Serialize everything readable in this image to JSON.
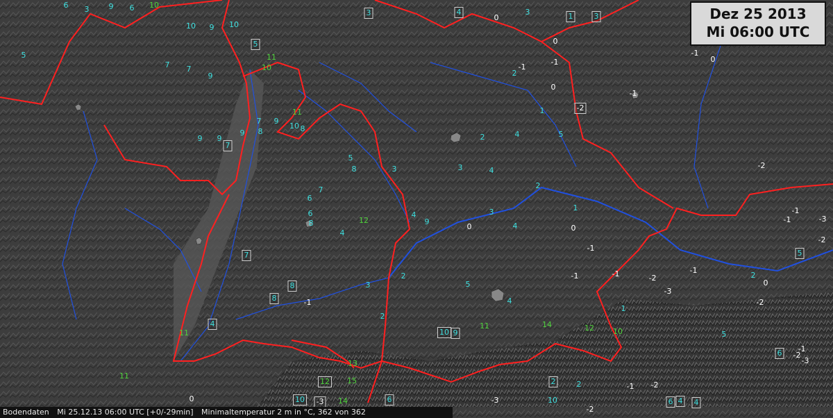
{
  "header": {
    "date": "Dez 25 2013",
    "time": "Mi 06:00 UTC"
  },
  "footer": {
    "source": "Bodendaten",
    "timestamp": "Mi 25.12.13 06:00 UTC [+0/-29min]",
    "description": "Minimaltemperatur 2 m in °C, 362 von 362"
  },
  "legend_colors": {
    "border": "#ff2020",
    "river": "#2050e0",
    "value_default": "#3fe0e0",
    "value_warm": "#4fd33c",
    "value_cold": "#ffffff"
  },
  "stations": [
    {
      "id": "s1",
      "v": "6",
      "c": "cyan"
    },
    {
      "id": "s2",
      "v": "3",
      "c": "cyan"
    },
    {
      "id": "s3",
      "v": "9",
      "c": "cyan"
    },
    {
      "id": "s4",
      "v": "6",
      "c": "cyan"
    },
    {
      "id": "s5",
      "v": "10",
      "c": "green"
    },
    {
      "id": "s6",
      "v": "3",
      "c": "cyan",
      "b": 1
    },
    {
      "id": "s7",
      "v": "4",
      "c": "cyan",
      "b": 1
    },
    {
      "id": "s8",
      "v": "0",
      "c": "white"
    },
    {
      "id": "s9",
      "v": "1",
      "c": "cyan",
      "b": 1
    },
    {
      "id": "s10",
      "v": "3",
      "c": "cyan",
      "b": 1
    },
    {
      "id": "s11",
      "v": "5",
      "c": "cyan"
    },
    {
      "id": "s12",
      "v": "10",
      "c": "cyan"
    },
    {
      "id": "s13",
      "v": "9",
      "c": "cyan"
    },
    {
      "id": "s14",
      "v": "10",
      "c": "cyan"
    },
    {
      "id": "s15",
      "v": "5",
      "c": "cyan",
      "b": 1
    },
    {
      "id": "s16",
      "v": "11",
      "c": "green"
    },
    {
      "id": "s17",
      "v": "10",
      "c": "green"
    },
    {
      "id": "s18",
      "v": "9",
      "c": "cyan"
    },
    {
      "id": "s19",
      "v": "7",
      "c": "cyan"
    },
    {
      "id": "s20",
      "v": "7",
      "c": "cyan"
    },
    {
      "id": "s21",
      "v": "11",
      "c": "green"
    },
    {
      "id": "s22",
      "v": "10",
      "c": "cyan"
    },
    {
      "id": "s23",
      "v": "8",
      "c": "cyan"
    },
    {
      "id": "s24",
      "v": "9",
      "c": "cyan"
    },
    {
      "id": "s25",
      "v": "7",
      "c": "cyan"
    },
    {
      "id": "s26",
      "v": "8",
      "c": "cyan"
    },
    {
      "id": "s27",
      "v": "9",
      "c": "cyan"
    },
    {
      "id": "s28",
      "v": "9",
      "c": "cyan"
    },
    {
      "id": "s29",
      "v": "7",
      "c": "cyan",
      "b": 1
    },
    {
      "id": "s30",
      "v": "9",
      "c": "cyan"
    },
    {
      "id": "s31",
      "v": "4",
      "c": "cyan"
    },
    {
      "id": "s32",
      "v": "5",
      "c": "cyan"
    },
    {
      "id": "s33",
      "v": "8",
      "c": "cyan"
    },
    {
      "id": "s34",
      "v": "3",
      "c": "cyan"
    },
    {
      "id": "s35",
      "v": "3",
      "c": "cyan"
    },
    {
      "id": "s36",
      "v": "4",
      "c": "cyan"
    },
    {
      "id": "s37",
      "v": "4",
      "c": "cyan"
    },
    {
      "id": "s38",
      "v": "2",
      "c": "cyan"
    },
    {
      "id": "s39",
      "v": "2",
      "c": "cyan"
    },
    {
      "id": "s40",
      "v": "1",
      "c": "cyan"
    },
    {
      "id": "s41",
      "v": "3",
      "c": "cyan"
    },
    {
      "id": "s42",
      "v": "0",
      "c": "white"
    },
    {
      "id": "s43",
      "v": "0",
      "c": "white"
    },
    {
      "id": "s44",
      "v": "-1",
      "c": "white"
    },
    {
      "id": "s45",
      "v": "-1",
      "c": "white"
    },
    {
      "id": "s46",
      "v": "-2",
      "c": "white",
      "b": 1
    },
    {
      "id": "s47",
      "v": "-1",
      "c": "white"
    },
    {
      "id": "s48",
      "v": "0",
      "c": "white"
    },
    {
      "id": "s49",
      "v": "-1",
      "c": "white"
    },
    {
      "id": "s50",
      "v": "-3",
      "c": "white"
    },
    {
      "id": "s51",
      "v": "-2",
      "c": "white"
    },
    {
      "id": "s52",
      "v": "-1",
      "c": "white"
    },
    {
      "id": "s53",
      "v": "0",
      "c": "white"
    },
    {
      "id": "s54",
      "v": "-2",
      "c": "white"
    },
    {
      "id": "s55",
      "v": "-1",
      "c": "white"
    },
    {
      "id": "s56",
      "v": "5",
      "c": "cyan",
      "b": 1
    },
    {
      "id": "s57",
      "v": "1",
      "c": "cyan"
    },
    {
      "id": "s58",
      "v": "10",
      "c": "green"
    },
    {
      "id": "s59",
      "v": "14",
      "c": "green"
    },
    {
      "id": "s60",
      "v": "12",
      "c": "green"
    },
    {
      "id": "s61",
      "v": "11",
      "c": "green"
    },
    {
      "id": "s62",
      "v": "10",
      "c": "cyan",
      "b": 1
    },
    {
      "id": "s63",
      "v": "9",
      "c": "cyan",
      "b": 1
    },
    {
      "id": "s64",
      "v": "13",
      "c": "green"
    },
    {
      "id": "s65",
      "v": "15",
      "c": "green"
    },
    {
      "id": "s66",
      "v": "12",
      "c": "green",
      "b": 1
    },
    {
      "id": "s67",
      "v": "10",
      "c": "cyan",
      "b": 1
    },
    {
      "id": "s68",
      "v": "-3",
      "c": "white",
      "b": 1
    },
    {
      "id": "s69",
      "v": "14",
      "c": "green"
    },
    {
      "id": "s70",
      "v": "6",
      "c": "cyan",
      "b": 1
    },
    {
      "id": "s71",
      "v": "-3",
      "c": "white"
    },
    {
      "id": "s72",
      "v": "0",
      "c": "white"
    },
    {
      "id": "s73",
      "v": "11",
      "c": "green"
    },
    {
      "id": "s74",
      "v": "-2",
      "c": "white"
    },
    {
      "id": "s75",
      "v": "-2",
      "c": "white"
    },
    {
      "id": "s76",
      "v": "-3",
      "c": "white"
    },
    {
      "id": "s77",
      "v": "-1",
      "c": "white"
    },
    {
      "id": "s78",
      "v": "5",
      "c": "cyan"
    },
    {
      "id": "s79",
      "v": "9",
      "c": "cyan"
    },
    {
      "id": "s80",
      "v": "2",
      "c": "cyan"
    },
    {
      "id": "s81",
      "v": "3",
      "c": "cyan"
    },
    {
      "id": "s82",
      "v": "4",
      "c": "cyan"
    },
    {
      "id": "s83",
      "v": "0",
      "c": "white"
    },
    {
      "id": "s84",
      "v": "2",
      "c": "cyan"
    },
    {
      "id": "s85",
      "v": "8",
      "c": "cyan",
      "b": 1
    },
    {
      "id": "s86",
      "v": "8",
      "c": "cyan",
      "b": 1
    },
    {
      "id": "s87",
      "v": "4",
      "c": "cyan",
      "b": 1
    },
    {
      "id": "s88",
      "v": "11",
      "c": "green"
    },
    {
      "id": "s89",
      "v": "7",
      "c": "cyan",
      "b": 1
    },
    {
      "id": "s90",
      "v": "12",
      "c": "green"
    },
    {
      "id": "s91",
      "v": "4",
      "c": "cyan"
    },
    {
      "id": "s92",
      "v": "6",
      "c": "cyan"
    },
    {
      "id": "s93",
      "v": "8",
      "c": "cyan"
    },
    {
      "id": "s94",
      "v": "6",
      "c": "cyan"
    },
    {
      "id": "s95",
      "v": "7",
      "c": "cyan"
    },
    {
      "id": "s96",
      "v": "5",
      "c": "cyan"
    },
    {
      "id": "s97",
      "v": "4",
      "c": "cyan"
    },
    {
      "id": "s98",
      "v": "3",
      "c": "cyan"
    },
    {
      "id": "s99",
      "v": "2",
      "c": "cyan"
    },
    {
      "id": "s100",
      "v": "-1",
      "c": "white"
    },
    {
      "id": "s101",
      "v": "-1",
      "c": "white"
    },
    {
      "id": "s102",
      "v": "1",
      "c": "cyan"
    },
    {
      "id": "s103",
      "v": "0",
      "c": "white"
    },
    {
      "id": "s104",
      "v": "-1",
      "c": "white"
    },
    {
      "id": "s105",
      "v": "-1",
      "c": "white"
    },
    {
      "id": "s106",
      "v": "-2",
      "c": "white"
    },
    {
      "id": "s107",
      "v": "-3",
      "c": "white"
    },
    {
      "id": "s108",
      "v": "2",
      "c": "cyan",
      "b": 1
    },
    {
      "id": "s109",
      "v": "-1",
      "c": "white"
    },
    {
      "id": "s110",
      "v": "-2",
      "c": "white"
    },
    {
      "id": "s111",
      "v": "4",
      "c": "cyan",
      "b": 1
    },
    {
      "id": "s112",
      "v": "10",
      "c": "cyan"
    },
    {
      "id": "s113",
      "v": "5",
      "c": "cyan"
    },
    {
      "id": "s114",
      "v": "2",
      "c": "cyan"
    },
    {
      "id": "s115",
      "v": "6",
      "c": "cyan",
      "b": 1
    },
    {
      "id": "s116",
      "v": "2",
      "c": "cyan"
    },
    {
      "id": "s117",
      "v": "6",
      "c": "cyan",
      "b": 1
    },
    {
      "id": "s118",
      "v": "-1",
      "c": "white"
    },
    {
      "id": "s119",
      "v": "-2",
      "c": "white"
    },
    {
      "id": "s120",
      "v": "4",
      "c": "cyan",
      "b": 1
    }
  ]
}
